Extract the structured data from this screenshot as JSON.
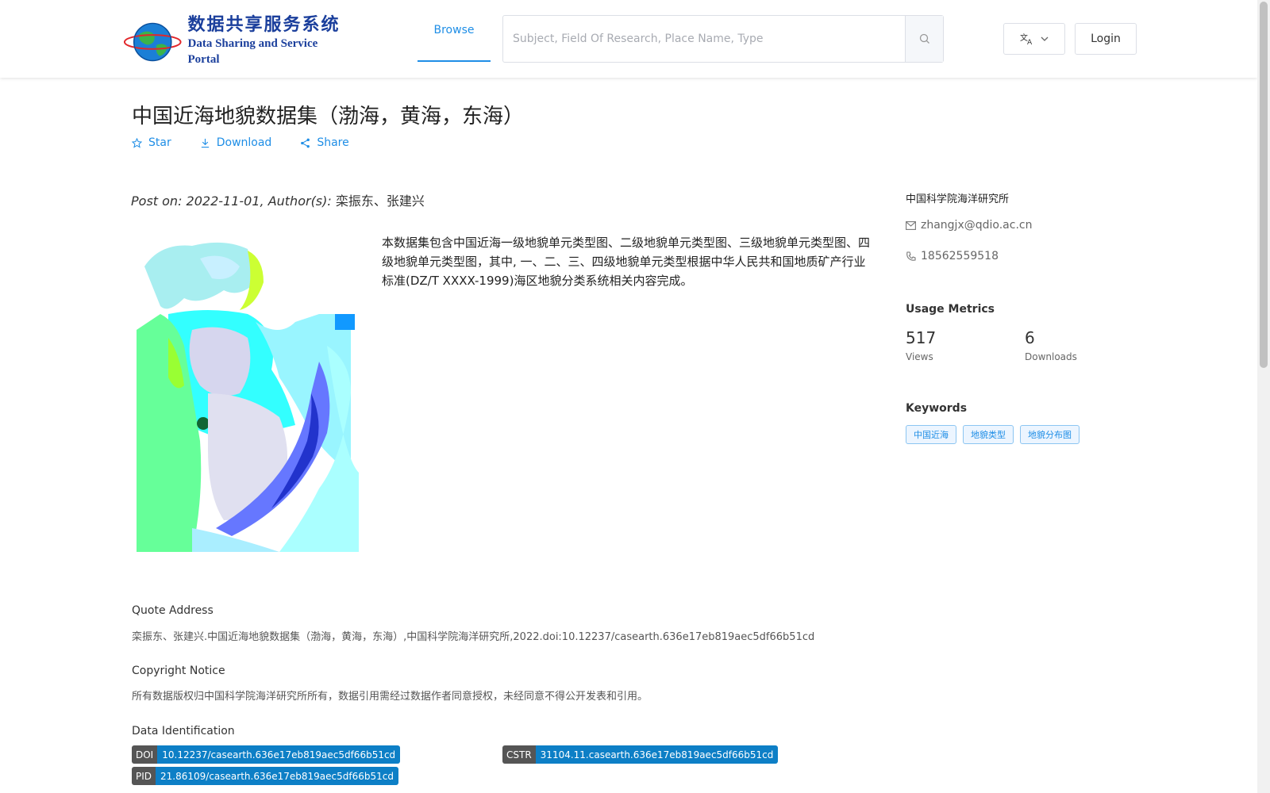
{
  "header": {
    "logo_cn": "数据共享服务系统",
    "logo_en": "Data Sharing and Service Portal",
    "nav_browse": "Browse",
    "search_placeholder": "Subject, Field Of Research, Place Name, Type",
    "search_value": "",
    "login": "Login"
  },
  "dataset": {
    "title": "中国近海地貌数据集（渤海，黄海，东海）",
    "actions": {
      "star": "Star",
      "download": "Download",
      "share": "Share"
    },
    "post_prefix": "Post on: 2022-11-01, Author(s): ",
    "authors": "栾振东、张建兴",
    "description": "本数据集包含中国近海一级地貌单元类型图、二级地貌单元类型图、三级地貌单元类型图、四级地貌单元类型图，其中, 一、二、三、四级地貌单元类型根据中华人民共和国地质矿产行业标准(DZ/T XXXX-1999)海区地貌分类系统相关内容完成。",
    "quote_label": "Quote Address",
    "quote_text": "栾振东、张建兴.中国近海地貌数据集（渤海，黄海，东海）,中国科学院海洋研究所,2022.doi:10.12237/casearth.636e17eb819aec5df66b51cd",
    "copyright_label": "Copyright Notice",
    "copyright_text": "所有数据版权归中国科学院海洋研究所所有，数据引用需经过数据作者同意授权，未经同意不得公开发表和引用。",
    "ident_label": "Data Identification",
    "ids": {
      "doi_key": "DOI",
      "doi_val": "10.12237/casearth.636e17eb819aec5df66b51cd",
      "cstr_key": "CSTR",
      "cstr_val": "31104.11.casearth.636e17eb819aec5df66b51cd",
      "pid_key": "PID",
      "pid_val": "21.86109/casearth.636e17eb819aec5df66b51cd"
    }
  },
  "sidebar": {
    "org": "中国科学院海洋研究所",
    "email": "zhangjx@qdio.ac.cn",
    "phone": "18562559518",
    "metrics_title": "Usage Metrics",
    "views": "517",
    "views_label": "Views",
    "downloads": "6",
    "downloads_label": "Downloads",
    "keywords_title": "Keywords",
    "keywords": [
      "中国近海",
      "地貌类型",
      "地貌分布图"
    ]
  },
  "colors": {
    "accent": "#1f8ee6",
    "id_value_bg": "#0d7fc6",
    "id_key_bg": "#555555"
  }
}
